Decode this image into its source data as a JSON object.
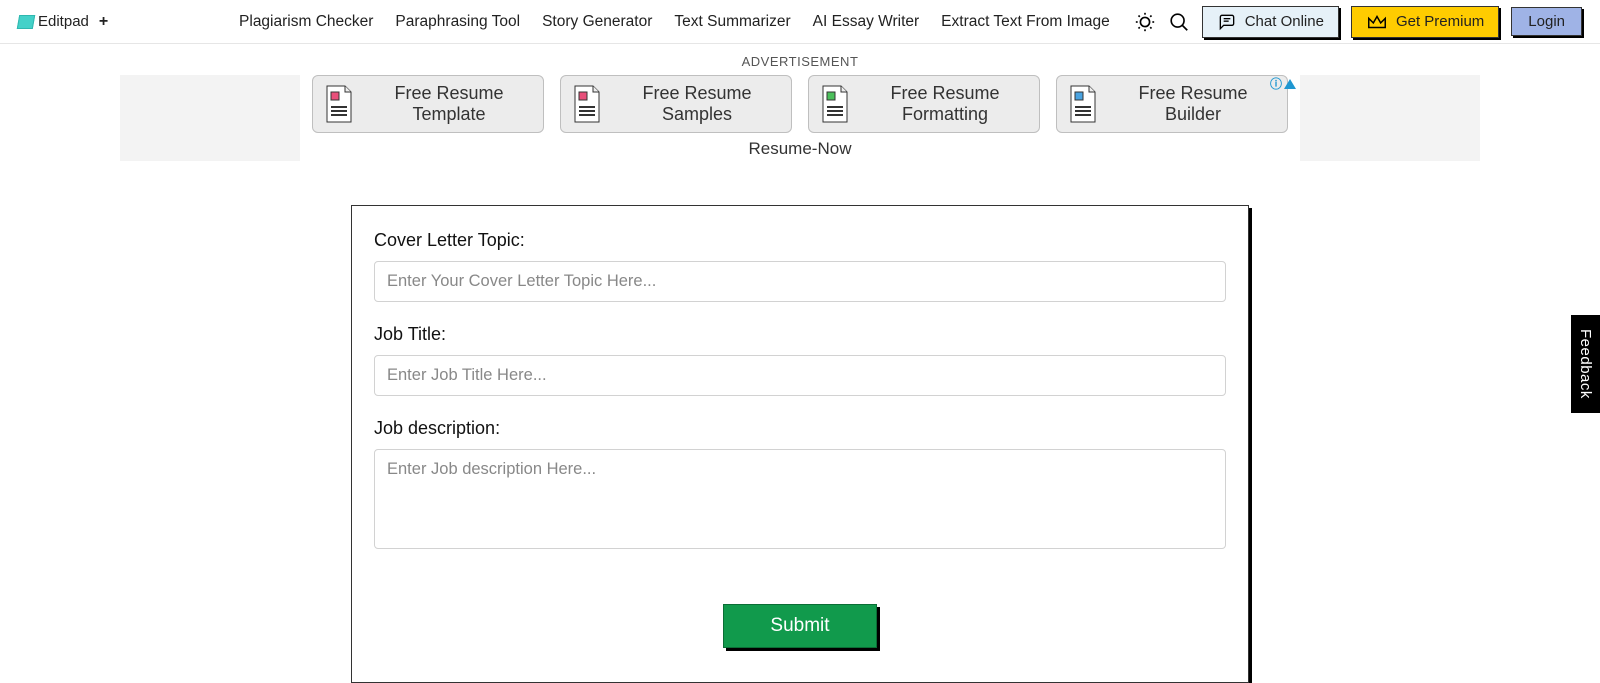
{
  "brand": {
    "name": "Editpad"
  },
  "nav": {
    "items": [
      "Plagiarism Checker",
      "Paraphrasing Tool",
      "Story Generator",
      "Text Summarizer",
      "AI Essay Writer",
      "Extract Text From Image"
    ]
  },
  "header": {
    "chat": "Chat Online",
    "premium": "Get Premium",
    "login": "Login"
  },
  "ad": {
    "label": "ADVERTISEMENT",
    "brand": "Resume-Now",
    "cards": [
      "Free Resume Template",
      "Free Resume Samples",
      "Free Resume Formatting",
      "Free Resume Builder"
    ]
  },
  "form": {
    "topic_label": "Cover Letter Topic:",
    "topic_placeholder": "Enter Your Cover Letter Topic Here...",
    "jobtitle_label": "Job Title:",
    "jobtitle_placeholder": "Enter Job Title Here...",
    "jobdesc_label": "Job description:",
    "jobdesc_placeholder": "Enter Job description Here...",
    "submit": "Submit"
  },
  "feedback": "Feedback"
}
